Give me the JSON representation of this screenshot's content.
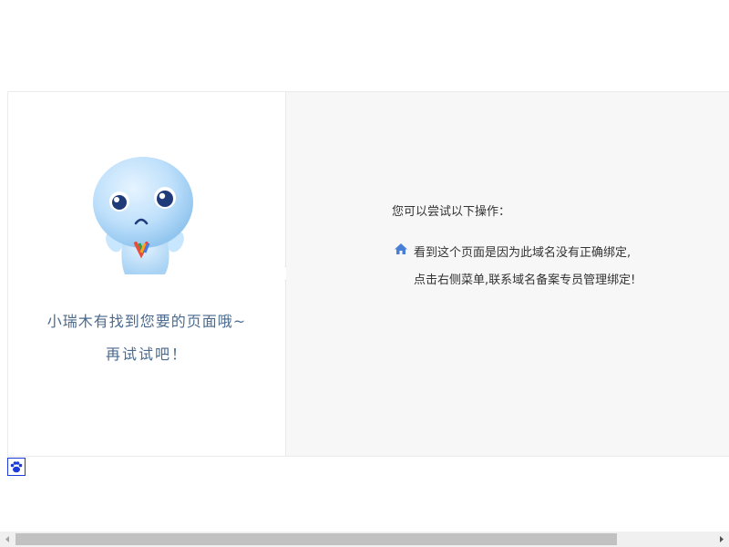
{
  "left": {
    "sad_message": "小瑞木有找到您要的页面哦~",
    "retry_message": "再试试吧！"
  },
  "right": {
    "try_label": "您可以尝试以下操作：",
    "reason_line1": "看到这个页面是因为此域名没有正确绑定,",
    "reason_line2": "点击右侧菜单,联系域名备案专员管理绑定!"
  },
  "icons": {
    "home": "home-icon",
    "paw": "paw-icon",
    "mascot": "sad-mascot"
  },
  "colors": {
    "accent_text": "#4a6a8e",
    "right_panel_bg": "#f7f7f7",
    "home_icon": "#4a7fd8",
    "paw_icon": "#1a3bd6"
  },
  "scrollbar": {
    "horizontal_position": 0
  }
}
